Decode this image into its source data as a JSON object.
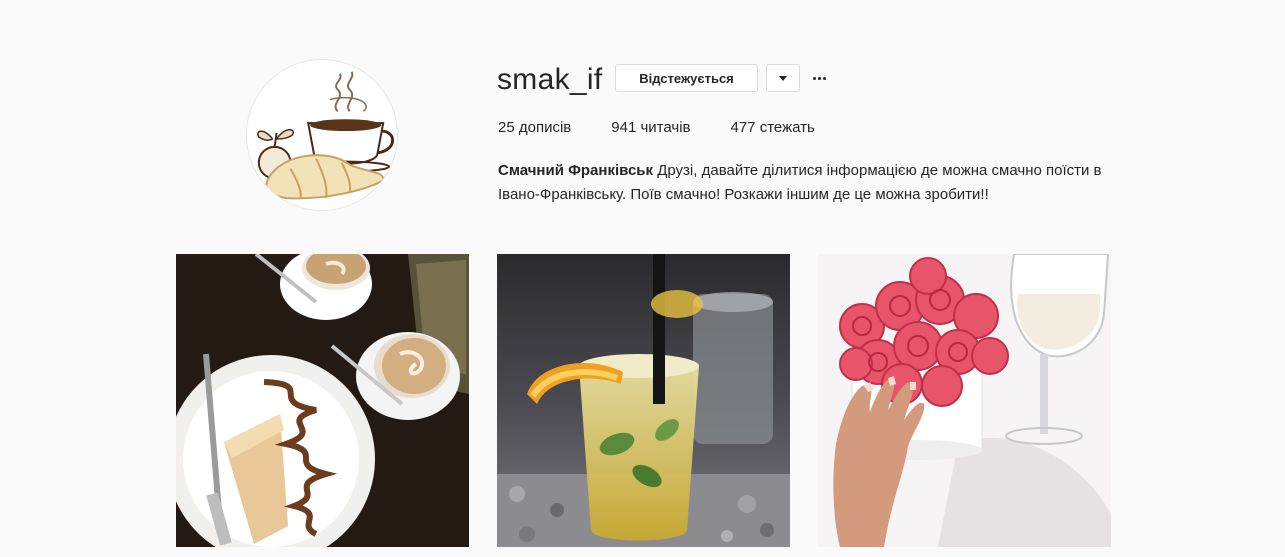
{
  "profile": {
    "username": "smak_if",
    "follow_button_label": "Відстежується",
    "dropdown_icon": "caret-down-icon",
    "more_icon": "ellipsis-icon",
    "stats": {
      "posts_count": "25",
      "posts_label": "дописів",
      "followers_count": "941",
      "followers_label": "читачів",
      "following_count": "477",
      "following_label": "стежать"
    },
    "full_name": "Смачний Франківськ",
    "bio_text": "Друзі, давайте ділитися інформацією де можна смачно поїсти в Івано-Франківську. Поїв смачно! Розкажи іншим де це можна зробити!!"
  },
  "posts": [
    {
      "subject": "cake-and-coffee"
    },
    {
      "subject": "lemonade-with-orange"
    },
    {
      "subject": "roses-and-wine"
    }
  ],
  "colors": {
    "background": "#fafafa",
    "text": "#262626",
    "border": "#dbdbdb",
    "coffee_brown": "#6b3d1e",
    "rose_pink": "#e8556a"
  }
}
